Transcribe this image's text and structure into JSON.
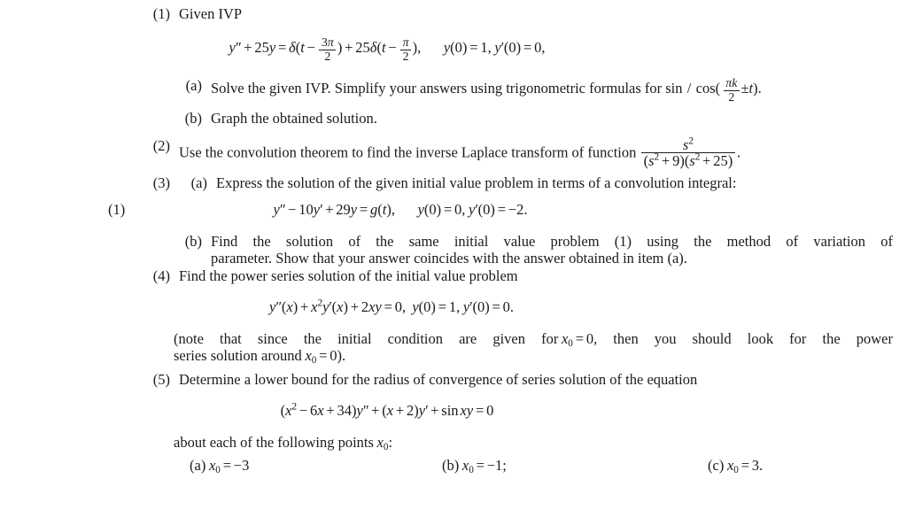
{
  "document": {
    "type": "mathematics-problem-set",
    "problems": [
      {
        "number": "(1)",
        "stem": "Given IVP",
        "equation": "y'' + 25y = δ(t − 3π/2) + 25δ(t − π/2),   y(0) = 1, y'(0) = 0,",
        "parts": [
          {
            "label": "(a)",
            "text_before": "Solve the given IVP. Simplify your answers using trigonometric formulas for sin / cos(",
            "formula": "πk/2 ± t",
            "text_after": ")."
          },
          {
            "label": "(b)",
            "text": "Graph the obtained solution."
          }
        ]
      },
      {
        "number": "(2)",
        "text": "Use the convolution theorem to find the inverse Laplace transform of function",
        "fraction_numerator": "s²",
        "fraction_denominator": "(s² + 9)(s² + 25)",
        "trailing_punctuation": "."
      },
      {
        "number": "(3)",
        "parts": [
          {
            "label": "(a)",
            "text": "Express the solution of the given initial value problem in terms of a convolution integral:"
          },
          {
            "label": "(b)",
            "line1": "Find the solution of the same initial value problem (1) using the method of variation of",
            "line2": "parameter. Show that your answer coincides with the answer obtained in item (a)."
          }
        ],
        "equation_tag": "(1)",
        "equation": "y'' − 10y' + 29y = g(t),   y(0) = 0, y'(0) = −2."
      },
      {
        "number": "(4)",
        "text": "Find the power series solution of the initial value problem",
        "equation": "y''(x) + x²y'(x) + 2xy = 0,  y(0) = 1, y'(0) = 0.",
        "note_line1": "(note that since the initial condition are given for x₀ = 0, then you should look for the power",
        "note_line2": "series solution around x₀ = 0)."
      },
      {
        "number": "(5)",
        "text": "Determine a lower bound for the radius of convergence of series solution of the equation",
        "equation": "(x² − 6x + 34)y'' + (x + 2)y' + sin xy = 0",
        "points_intro": "about each of the following points x₀:",
        "points": [
          {
            "label": "(a)",
            "value": "x₀ = −3"
          },
          {
            "label": "(b)",
            "value": "x₀ = −1;"
          },
          {
            "label": "(c)",
            "value": "x₀ = 3."
          }
        ]
      }
    ]
  },
  "labels": {
    "p1_number": "(1)",
    "p1_stem": "Given IVP",
    "p1a_label": "(a)",
    "p1a_text_before": "Solve the given IVP. Simplify your answers using trigonometric formulas for sin",
    "p1a_slash": "/",
    "p1a_cos": "cos(",
    "p1a_text_after": ").",
    "p1b_label": "(b)",
    "p1b_text": "Graph the obtained solution.",
    "p2_number": "(2)",
    "p2_text": "Use the convolution theorem to find the inverse Laplace transform of function",
    "p2_period": ".",
    "p3_number": "(3)",
    "p3a_label": "(a)",
    "p3a_text": "Express the solution of the given initial value problem in terms of a convolution integral:",
    "p3_eq_tag": "(1)",
    "p3b_label": "(b)",
    "p3b_line1": "Find the solution of the same initial value problem (1) using the method of variation of",
    "p3b_line2": "parameter. Show that your answer coincides with the answer obtained in item (a).",
    "p4_number": "(4)",
    "p4_text": "Find the power series solution of the initial value problem",
    "p4_note1_a": "(note that since the initial condition are given for",
    "p4_note1_b": ", then you should look for the power",
    "p4_note2_a": "series solution around",
    "p4_note2_b": ").",
    "p5_number": "(5)",
    "p5_text": "Determine a lower bound for the radius of convergence of series solution of the equation",
    "p5_points_intro_a": "about each of the following points",
    "p5_points_intro_b": ":",
    "p5a_label": "(a)",
    "p5b_label": "(b)",
    "p5c_label": "(c)"
  },
  "symbols": {
    "y": "y",
    "x": "x",
    "s": "s",
    "t": "t",
    "k": "k",
    "g": "g",
    "delta": "δ",
    "pi": "π",
    "prime1": "′",
    "prime2": "″",
    "plus": "+",
    "minus": "−",
    "pm": "±",
    "equals": "=",
    "comma": ",",
    "period": ".",
    "semicolon": ";",
    "lparen": "(",
    "rparen": ")",
    "zero": "0",
    "one": "1",
    "two": "2",
    "three": "3",
    "sin": "sin",
    "cos": "cos"
  },
  "numbers": {
    "n0": "0",
    "n1": "1",
    "n2": "2",
    "n3": "3",
    "n9": "9",
    "n10": "10",
    "n25": "25",
    "n29": "29",
    "n34": "34",
    "n6": "6",
    "neg1": "−1",
    "neg2": "−2",
    "neg3": "−3",
    "sq": "2"
  },
  "colors": {
    "page_background": "#ffffff",
    "text": "#1a1a22"
  }
}
